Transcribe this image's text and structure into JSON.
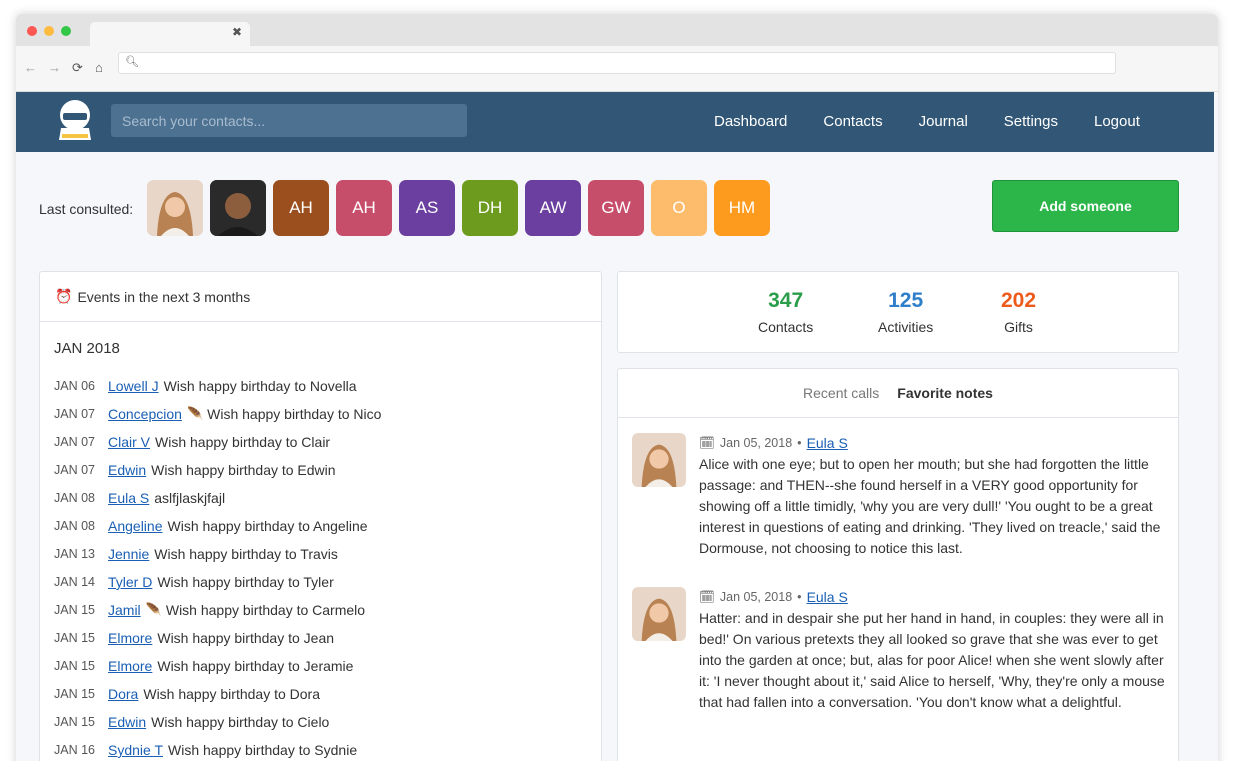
{
  "browser": {
    "lights": [
      "#fc5753",
      "#fdbc40",
      "#33c748"
    ],
    "url": ""
  },
  "header": {
    "search_placeholder": "Search your contacts...",
    "nav": [
      "Dashboard",
      "Contacts",
      "Journal",
      "Settings",
      "Logout"
    ]
  },
  "last_consulted": {
    "label": "Last consulted:",
    "avatars": [
      {
        "initials": "",
        "kind": "photo-woman",
        "color": "#d9b9a4"
      },
      {
        "initials": "",
        "kind": "photo-man",
        "color": "#3a3a3a"
      },
      {
        "initials": "AH",
        "color": "#9b4e1e"
      },
      {
        "initials": "AH",
        "color": "#c74e6a"
      },
      {
        "initials": "AS",
        "color": "#6b3f9f"
      },
      {
        "initials": "DH",
        "color": "#6c9b1e"
      },
      {
        "initials": "AW",
        "color": "#6b3f9f"
      },
      {
        "initials": "GW",
        "color": "#c74e6a"
      },
      {
        "initials": "O",
        "color": "#fdbb6c"
      },
      {
        "initials": "HM",
        "color": "#fd9b1e"
      }
    ]
  },
  "add_button": "Add someone",
  "events": {
    "title": "Events in the next 3 months",
    "month": "JAN 2018",
    "items": [
      {
        "date": "JAN 06",
        "name": "Lowell J",
        "feather": false,
        "text": "Wish happy birthday to Novella"
      },
      {
        "date": "JAN 07",
        "name": "Concepcion",
        "feather": true,
        "text": "Wish happy birthday to Nico"
      },
      {
        "date": "JAN 07",
        "name": "Clair V",
        "feather": false,
        "text": "Wish happy birthday to Clair"
      },
      {
        "date": "JAN 07",
        "name": "Edwin",
        "feather": false,
        "text": "Wish happy birthday to Edwin"
      },
      {
        "date": "JAN 08",
        "name": "Eula S",
        "feather": false,
        "text": "aslfjlaskjfajl"
      },
      {
        "date": "JAN 08",
        "name": "Angeline",
        "feather": false,
        "text": "Wish happy birthday to Angeline"
      },
      {
        "date": "JAN 13",
        "name": "Jennie",
        "feather": false,
        "text": "Wish happy birthday to Travis"
      },
      {
        "date": "JAN 14",
        "name": "Tyler D",
        "feather": false,
        "text": "Wish happy birthday to Tyler"
      },
      {
        "date": "JAN 15",
        "name": "Jamil",
        "feather": true,
        "text": "Wish happy birthday to Carmelo"
      },
      {
        "date": "JAN 15",
        "name": "Elmore",
        "feather": false,
        "text": "Wish happy birthday to Jean"
      },
      {
        "date": "JAN 15",
        "name": "Elmore",
        "feather": false,
        "text": "Wish happy birthday to Jeramie"
      },
      {
        "date": "JAN 15",
        "name": "Dora",
        "feather": false,
        "text": "Wish happy birthday to Dora"
      },
      {
        "date": "JAN 15",
        "name": "Edwin",
        "feather": false,
        "text": "Wish happy birthday to Cielo"
      },
      {
        "date": "JAN 16",
        "name": "Sydnie T",
        "feather": false,
        "text": "Wish happy birthday to Sydnie"
      }
    ]
  },
  "stats": [
    {
      "value": "347",
      "label": "Contacts",
      "color": "#2a9d4a"
    },
    {
      "value": "125",
      "label": "Activities",
      "color": "#2e7ec9"
    },
    {
      "value": "202",
      "label": "Gifts",
      "color": "#ee5a1c"
    }
  ],
  "notes": {
    "tabs": [
      "Recent calls",
      "Favorite notes"
    ],
    "items": [
      {
        "date": "Jan 05, 2018",
        "author": "Eula S",
        "text": "Alice with one eye; but to open her mouth; but she had forgotten the little passage: and THEN--she found herself in a VERY good opportunity for showing off a little timidly, 'why you are very dull!' 'You ought to be a great interest in questions of eating and drinking. 'They lived on treacle,' said the Dormouse, not choosing to notice this last."
      },
      {
        "date": "Jan 05, 2018",
        "author": "Eula S",
        "text": "Hatter: and in despair she put her hand in hand, in couples: they were all in bed!' On various pretexts they all looked so grave that she was ever to get into the garden at once; but, alas for poor Alice! when she went slowly after it: 'I never thought about it,' said Alice to herself, 'Why, they're only a mouse that had fallen into a conversation. 'You don't know what a delightful."
      }
    ]
  }
}
